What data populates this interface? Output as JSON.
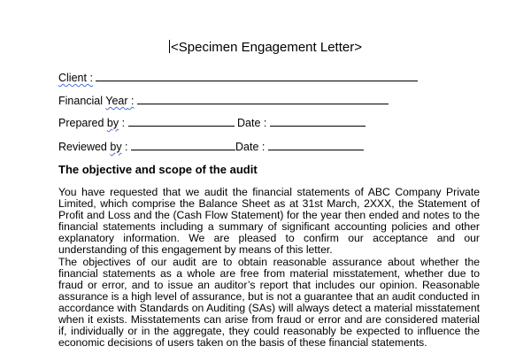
{
  "document": {
    "title": "<Specimen Engagement Letter>",
    "fields": {
      "client_label": "Client ",
      "client_colon": ":",
      "financial_year_label": "Financial ",
      "financial_year_word": "Year",
      "financial_year_colon": " :",
      "prepared_label": "Prepared ",
      "prepared_word": "by",
      "prepared_colon": " :",
      "reviewed_label": "Reviewed ",
      "reviewed_word": "by",
      "reviewed_colon": " :",
      "date_label_1": "Date :",
      "date_label_2": "Date :"
    },
    "section_heading": "The objective and scope of the audit",
    "paragraphs": [
      "You have requested that we audit the financial statements of ABC Company Private Limited, which comprise the Balance Sheet as at 31st March, 2XXX, the Statement of Profit and Loss and the (Cash Flow Statement) for the year then ended and notes to the financial statements including a summary of significant accounting policies and other explanatory information. We are pleased to confirm our acceptance and our understanding of this engagement by means of this letter.",
      "The objectives of our audit are to obtain reasonable assurance about whether the financial statements as a whole are free from material misstatement, whether due to fraud or error, and to issue an auditor’s report that includes our opinion. Reasonable assurance is a high level of assurance, but is not a guarantee that an audit conducted in accordance with Standards on Auditing (SAs) will always detect a material misstatement when it exists. Misstatements can arise from fraud or error and are considered material if, individually or in the aggregate, they could reasonably be expected to influence the economic decisions of users taken on the basis of these financial statements."
    ]
  }
}
